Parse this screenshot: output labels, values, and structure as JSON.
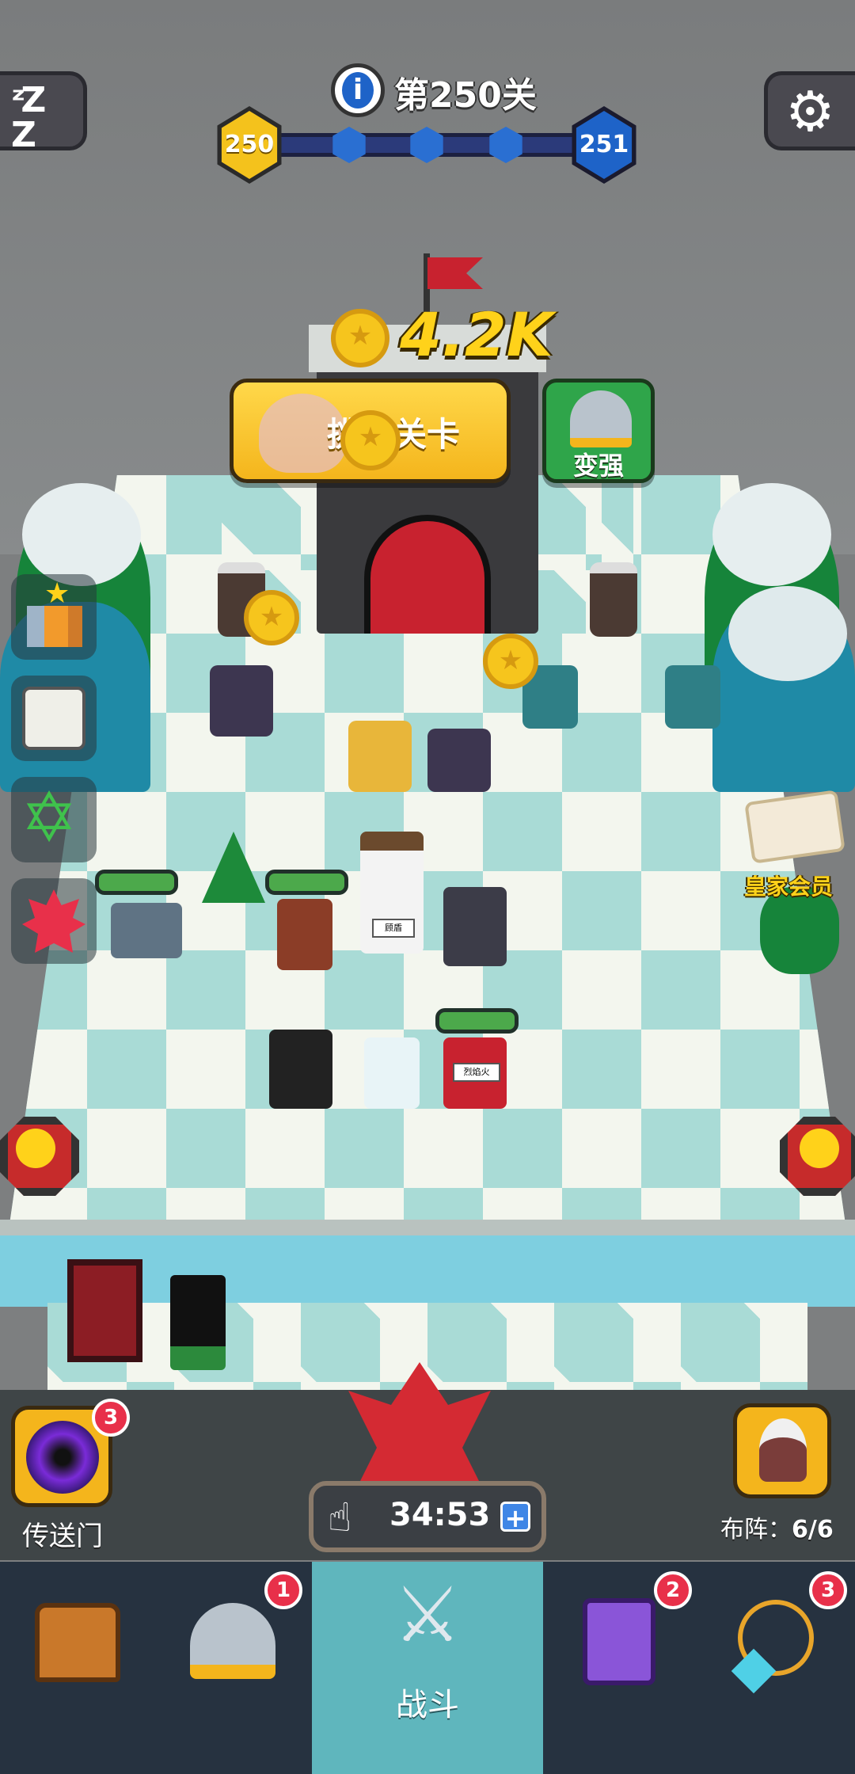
{
  "header": {
    "level_title": "第250关",
    "current_level": "250",
    "next_level": "251",
    "progress_steps": 3
  },
  "reward": {
    "amount": "4.2K",
    "challenge_button": "挑战关卡",
    "upgrade_button": "变强"
  },
  "units": {
    "hero_label_1": "顾盾",
    "hero_label_2": "烈焰火"
  },
  "side_menu": {
    "items": [
      "ranking-icon",
      "scroll-icon",
      "hexagram-icon",
      "maple-leaf-icon"
    ]
  },
  "royal_member": "皇家会员",
  "portal": {
    "label": "传送门",
    "badge": "3"
  },
  "timer": {
    "value": "34:53"
  },
  "formation": {
    "label": "布阵：",
    "value": "6/6"
  },
  "nav": {
    "tabs": [
      {
        "icon": "treasure-chest-icon",
        "label": "",
        "badge": ""
      },
      {
        "icon": "viking-helmet-icon",
        "label": "",
        "badge": "1"
      },
      {
        "icon": "crossed-swords-icon",
        "label": "战斗",
        "badge": ""
      },
      {
        "icon": "spellbook-icon",
        "label": "",
        "badge": "2"
      },
      {
        "icon": "amulet-icon",
        "label": "",
        "badge": "3"
      }
    ]
  },
  "colors": {
    "gold": "#f6c51d",
    "level_current": "#f4c21c",
    "level_next": "#1e63c8",
    "badge_red": "#e8304a",
    "tab_active": "#5fb6bd"
  }
}
